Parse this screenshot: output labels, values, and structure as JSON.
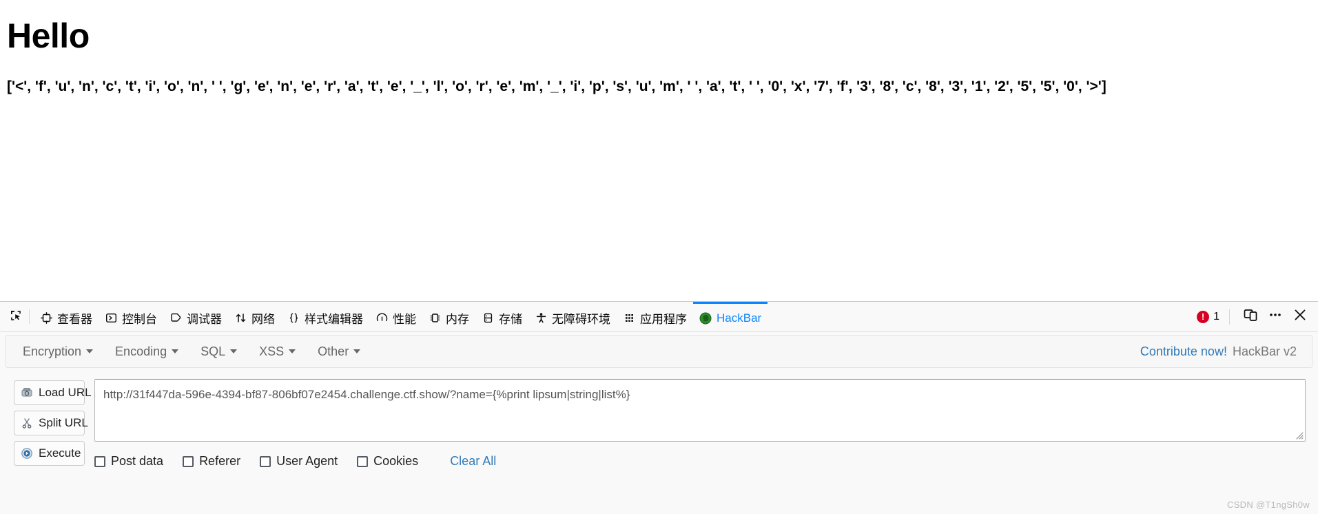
{
  "page": {
    "title": "Hello",
    "body_text": "['<', 'f', 'u', 'n', 'c', 't', 'i', 'o', 'n', ' ', 'g', 'e', 'n', 'e', 'r', 'a', 't', 'e', '_', 'l', 'o', 'r', 'e', 'm', '_', 'i', 'p', 's', 'u', 'm', ' ', 'a', 't', ' ', '0', 'x', '7', 'f', '3', '8', 'c', '8', '3', '1', '2', '5', '5', '0', '>']"
  },
  "devtools": {
    "picker_icon": "element-picker-icon",
    "tabs": [
      {
        "label": "查看器",
        "icon": "inspector-icon",
        "active": false
      },
      {
        "label": "控制台",
        "icon": "console-icon",
        "active": false
      },
      {
        "label": "调试器",
        "icon": "debugger-icon",
        "active": false
      },
      {
        "label": "网络",
        "icon": "network-icon",
        "active": false
      },
      {
        "label": "样式编辑器",
        "icon": "style-editor-icon",
        "active": false
      },
      {
        "label": "性能",
        "icon": "performance-icon",
        "active": false
      },
      {
        "label": "内存",
        "icon": "memory-icon",
        "active": false
      },
      {
        "label": "存储",
        "icon": "storage-icon",
        "active": false
      },
      {
        "label": "无障碍环境",
        "icon": "accessibility-icon",
        "active": false
      },
      {
        "label": "应用程序",
        "icon": "application-icon",
        "active": false
      },
      {
        "label": "HackBar",
        "icon": "hackbar-firefox-icon",
        "active": true
      }
    ],
    "error_count": "1",
    "error_icon": "error-exclamation-icon",
    "responsive_icon": "responsive-design-mode-icon",
    "meta_icon": "more-options-icon",
    "close_icon": "close-icon",
    "active_tab_color": "#0a84ff",
    "error_color": "#d70022"
  },
  "hackbar": {
    "menus": [
      {
        "label": "Encryption"
      },
      {
        "label": "Encoding"
      },
      {
        "label": "SQL"
      },
      {
        "label": "XSS"
      },
      {
        "label": "Other"
      }
    ],
    "contribute_label": "Contribute now!",
    "version_label": "HackBar v2",
    "buttons": [
      {
        "label": "Load URL",
        "icon": "load-url-icon"
      },
      {
        "label": "Split URL",
        "icon": "split-url-scissors-icon"
      },
      {
        "label": "Execute",
        "icon": "execute-play-icon"
      }
    ],
    "url_value": "http://31f447da-596e-4394-bf87-806bf07e2454.challenge.ctf.show/?name={%print lipsum|string|list%}",
    "url_placeholder": "",
    "checkboxes": [
      {
        "label": "Post data",
        "checked": false
      },
      {
        "label": "Referer",
        "checked": false
      },
      {
        "label": "User Agent",
        "checked": false
      },
      {
        "label": "Cookies",
        "checked": false
      }
    ],
    "clear_all_label": "Clear All",
    "link_color": "#337ab7"
  },
  "watermark": "CSDN @T1ngSh0w"
}
